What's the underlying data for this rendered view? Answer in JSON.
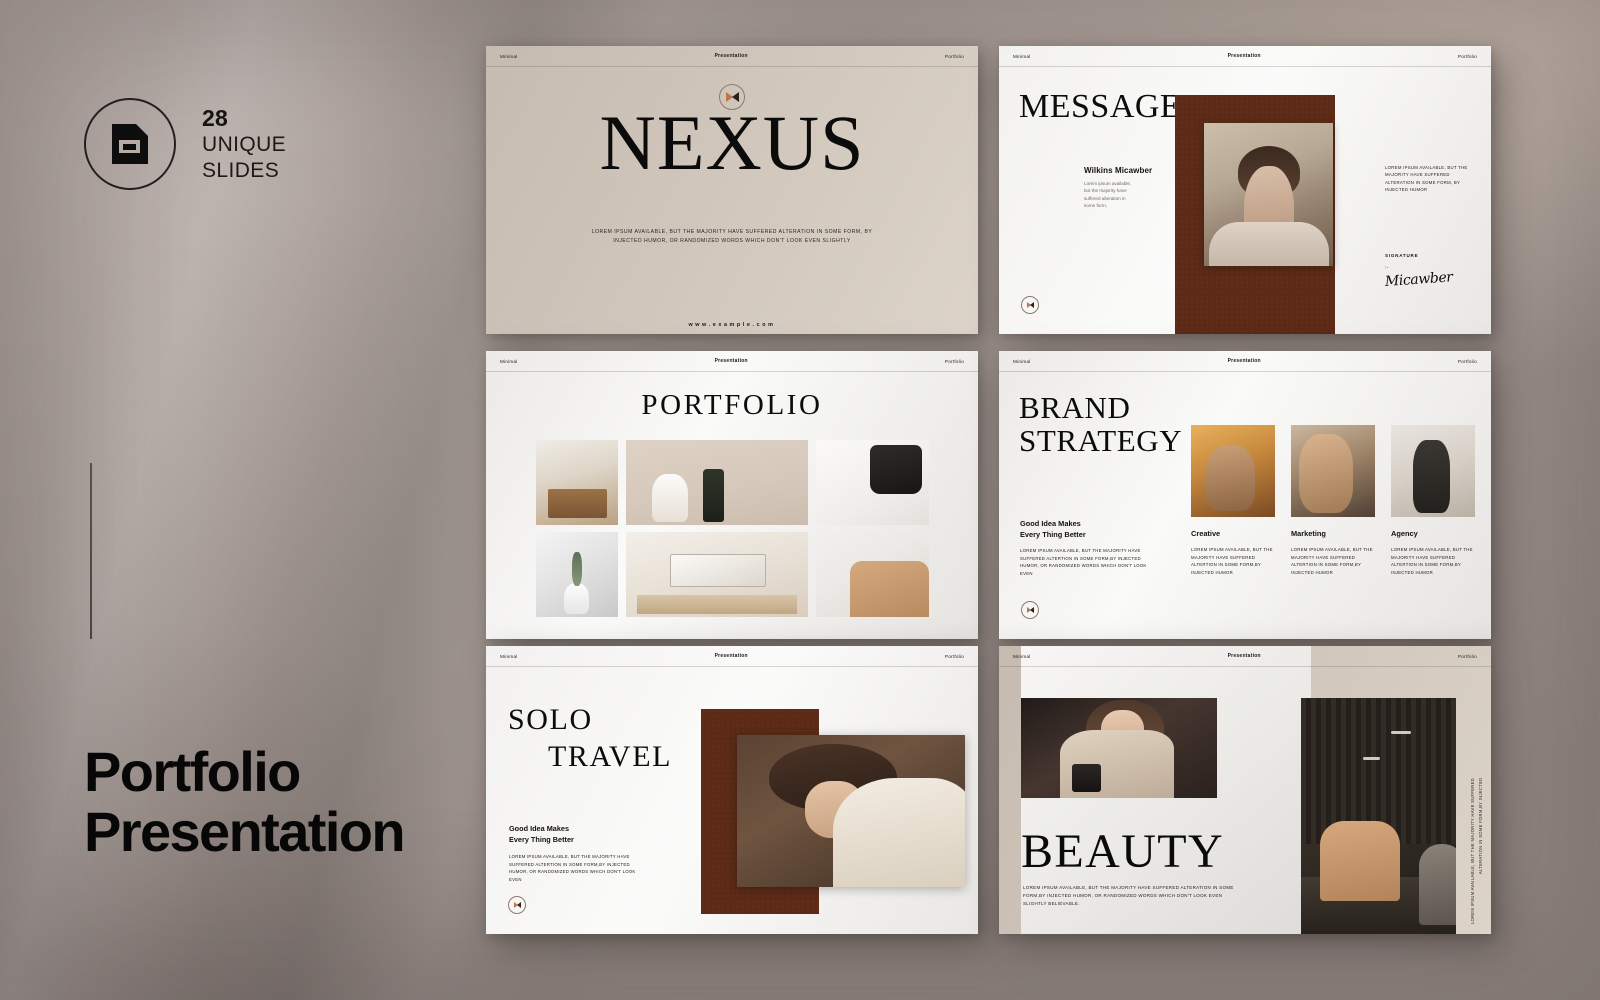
{
  "backdrop": {
    "accent_brown": "#5c2a17",
    "bg_mauve": "#a79d98"
  },
  "promo": {
    "badge": {
      "icon": "slide-card-icon",
      "count": "28",
      "line1": "UNIQUE",
      "line2": "SLIDES"
    },
    "title_line1": "Portfolio",
    "title_line2": "Presentation"
  },
  "slide_header": {
    "left": "Minimal",
    "center": "Presentation",
    "right": "Portfolio"
  },
  "slides": [
    {
      "id": "nexus",
      "logo": "play-mark-logo",
      "title": "NEXUS",
      "subtitle": "LOREM IPSUM AVAILABLE, BUT THE MAJORITY HAVE SUFFERED ALTERATION  IN SOME FORM, BY INJECTED HUMOR, OR RANDOMIZED  WORDS WHICH DON'T LOOK EVEN SLIGHTLY",
      "url": "www.example.com"
    },
    {
      "id": "message",
      "title": "MESSAGE",
      "person_name": "Wilkins Micawber",
      "person_body": "Lorem ipsum available, but the majority have suffered alteration in some form,",
      "right_body": "LOREM IPSUM AVAILABLE, BUT THE MAJORITY HAVE SUFFERED ALTERATION IN SOME FORM, BY INJECTED HUMOR",
      "signature_label": "SIGNATURE",
      "signature_dash": ":-",
      "signature_name": "Micawber",
      "photo_alt": "portrait-woman-blazer"
    },
    {
      "id": "portfolio",
      "title": "PORTFOLIO",
      "gallery": [
        {
          "alt": "dining-table-chairs"
        },
        {
          "alt": "vase-soap-bottles"
        },
        {
          "alt": "black-mug-pen"
        },
        {
          "alt": "white-vase-plant"
        },
        {
          "alt": "laptop-on-desk"
        },
        {
          "alt": "tan-sofa-cushions"
        }
      ]
    },
    {
      "id": "brand-strategy",
      "title_line1": "BRAND",
      "title_line2": "STRATEGY",
      "sub_line1": "Good Idea Makes",
      "sub_line2": "Every Thing Better",
      "body": "LOREM IPSUM AVAILABLE, BUT THE MAJORITY HAVE SUFFERED ALTERTION IN SOME FORM,BY INJECTED HUMOR, OR RANDOMIZED  WORDS WHICH DON'T LOOK EVEN",
      "columns": [
        {
          "heading": "Creative",
          "body": "LOREM IPSUM AVAILABLE, BUT THE MAJORITY HAVE SUFFERED ALTERTION IN SOME FORM,BY INJECTED HUMOR",
          "alt": "woman-gold-jewellery"
        },
        {
          "heading": "Marketing",
          "body": "LOREM IPSUM AVAILABLE, BUT THE MAJORITY HAVE SUFFERED ALTERTION IN SOME FORM,BY INJECTED HUMOR",
          "alt": "woman-earring-profile"
        },
        {
          "heading": "Agency",
          "body": "LOREM IPSUM AVAILABLE, BUT THE MAJORITY HAVE SUFFERED ALTERTION IN SOME FORM,BY INJECTED HUMOR",
          "alt": "woman-working-desk"
        }
      ]
    },
    {
      "id": "solo-travel",
      "title_line1": "SOLO",
      "title_line2": "TRAVEL",
      "sub_line1": "Good Idea Makes",
      "sub_line2": "Every Thing Better",
      "body": "LOREM IPSUM AVAILABLE,  BUT THE MAJORITY HAVE SUFFERED ALTERTION IN SOME FORM,BY INJECTED HUMOR, OR RANDOMIZED  WORDS WHICH DON'T LOOK EVEN",
      "photo_alt": "smiling-woman-hat"
    },
    {
      "id": "beauty",
      "title": "BEAUTY",
      "body": "LOREM IPSUM AVAILABLE, BUT THE MAJORITY  HAVE SUFFERED ALTERATION IN SOME FORM,BY INJECTED HUMOR, OR RANDOMIZED  WORDS WHICH DON'T LOOK EVEN SLIGHTLY  BELIEVABLE.",
      "vertical_text": "LOREM IPSUM AVAILABLE, BUT THE MAJORITY HAVE SUFFERED\nALTERATION IN SOME FORM,BY INJECTED",
      "photo_alt": "woman-coffee-phone",
      "photo2_alt": "lounge-interior-sofa"
    }
  ]
}
